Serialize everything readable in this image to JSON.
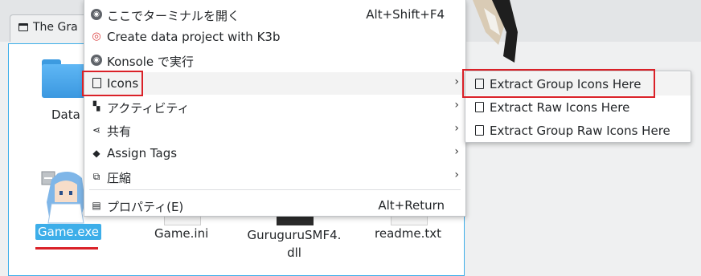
{
  "window": {
    "tab_title": "The Gra"
  },
  "files": [
    {
      "label": "Data",
      "icon": "folder-icon"
    },
    {
      "label": "Game.exe",
      "icon": "game-character-icon",
      "selected": true
    },
    {
      "label": "Game.ini",
      "icon": "text-file-icon"
    },
    {
      "label": "GuruguruSMF4.\ndll",
      "icon": "dll-file-icon"
    },
    {
      "label": "readme.txt",
      "icon": "text-file-icon"
    }
  ],
  "context_menu": {
    "items": [
      {
        "label": "ここでターミナルを開く",
        "shortcut": "Alt+Shift+F4",
        "icon": "terminal-icon"
      },
      {
        "label": "Create data project with K3b",
        "icon": "k3b-icon"
      },
      {
        "label": "Konsole で実行",
        "icon": "konsole-icon"
      },
      {
        "label": "Icons",
        "icon": "document-icon",
        "submenu": true,
        "highlighted": true
      },
      {
        "label": "アクティビティ",
        "icon": "activities-icon",
        "submenu": true
      },
      {
        "label": "共有",
        "icon": "share-icon",
        "submenu": true
      },
      {
        "label": "Assign Tags",
        "icon": "tag-icon",
        "submenu": true
      },
      {
        "label": "圧縮",
        "icon": "archive-icon",
        "submenu": true
      },
      {
        "label": "プロパティ(E)",
        "shortcut": "Alt+Return",
        "icon": "properties-icon"
      }
    ]
  },
  "submenu": {
    "items": [
      {
        "label": "Extract Group Icons Here",
        "highlighted": true
      },
      {
        "label": "Extract Raw Icons Here"
      },
      {
        "label": "Extract Group Raw Icons Here"
      }
    ]
  },
  "colors": {
    "accent": "#3daee9",
    "annotation_red": "#da2128"
  }
}
